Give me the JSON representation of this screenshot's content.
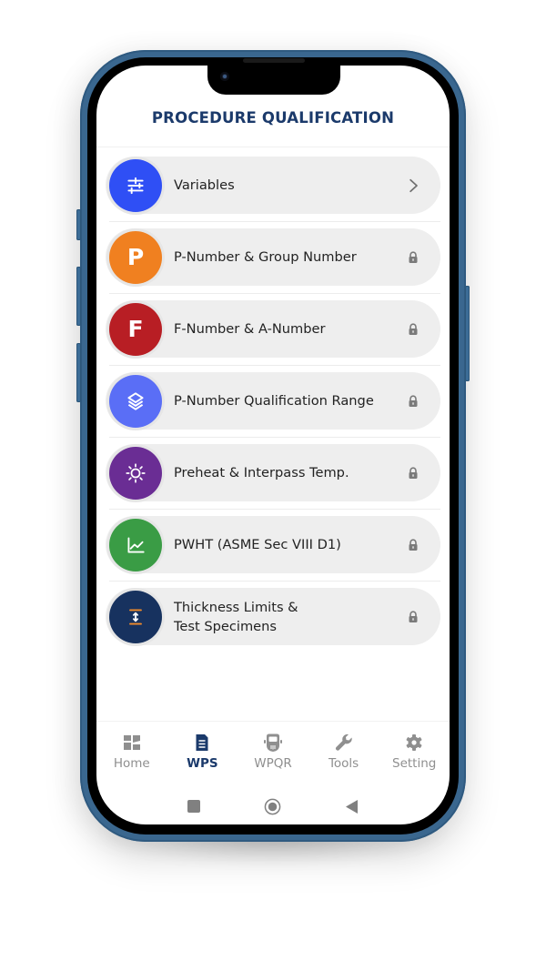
{
  "header": {
    "title": "PROCEDURE QUALIFICATION"
  },
  "menu": {
    "items": [
      {
        "label": "Variables",
        "icon": "sliders-icon",
        "icon_color": "#2f4ff5",
        "trailing": "chevron-right-icon",
        "locked": false
      },
      {
        "label": "P-Number & Group Number",
        "icon": "letter-p-icon",
        "icon_text": "P",
        "icon_color": "#f08020",
        "trailing": "lock-icon",
        "locked": true
      },
      {
        "label": "F-Number & A-Number",
        "icon": "letter-f-icon",
        "icon_text": "F",
        "icon_color": "#b81e24",
        "trailing": "lock-icon",
        "locked": true
      },
      {
        "label": "P-Number Qualification Range",
        "icon": "layers-icon",
        "icon_color": "#5a6ef6",
        "trailing": "lock-icon",
        "locked": true
      },
      {
        "label": "Preheat & Interpass Temp.",
        "icon": "sun-icon",
        "icon_color": "#6a2d94",
        "trailing": "lock-icon",
        "locked": true
      },
      {
        "label": "PWHT (ASME Sec VIII D1)",
        "icon": "line-chart-icon",
        "icon_color": "#3a9c45",
        "trailing": "lock-icon",
        "locked": true
      },
      {
        "label": "Thickness Limits &\nTest Specimens",
        "icon": "thickness-icon",
        "icon_color": "#17325f",
        "accent_color": "#f08a2a",
        "trailing": "lock-icon",
        "locked": true
      }
    ]
  },
  "tabbar": {
    "active_color": "#1b3a6b",
    "inactive_color": "#8f8f8f",
    "tabs": [
      {
        "label": "Home",
        "icon": "dashboard-icon",
        "active": false
      },
      {
        "label": "WPS",
        "icon": "document-icon",
        "active": true
      },
      {
        "label": "WPQR",
        "icon": "welding-helmet-icon",
        "active": false
      },
      {
        "label": "Tools",
        "icon": "wrench-icon",
        "active": false
      },
      {
        "label": "Setting",
        "icon": "gear-icon",
        "active": false
      }
    ]
  },
  "system_nav": {
    "buttons": [
      "recents",
      "home",
      "back"
    ]
  },
  "device": {
    "frame_color": "#3a678f"
  }
}
